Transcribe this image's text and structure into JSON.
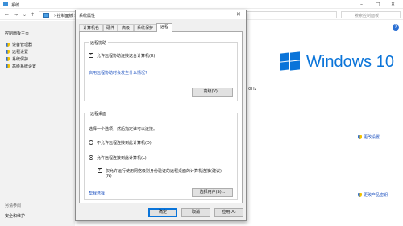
{
  "bg_window": {
    "title": "系统",
    "controls": [
      "–",
      "□",
      "✕"
    ],
    "breadcrumb": "› 控制面板 ›",
    "search_placeholder": "搜索控制面板",
    "left_pane": {
      "home": "控制面板主页",
      "items": [
        "设备管理器",
        "远程设置",
        "系统保护",
        "高级系统设置"
      ],
      "see_also": "另请参阅",
      "security": "安全和维护"
    },
    "logo_text": "Windows 10",
    "fragment_ghz": "GHz",
    "change_settings": "更改设置",
    "change_key": "更改产品密钥"
  },
  "dialog": {
    "title": "系统属性",
    "close": "✕",
    "tabs": [
      {
        "label": "计算机名"
      },
      {
        "label": "硬件"
      },
      {
        "label": "高级"
      },
      {
        "label": "系统保护"
      },
      {
        "label": "远程"
      }
    ],
    "active_tab": "远程",
    "remote_assistance": {
      "title": "远程协助",
      "allow_label": "允许远程协助连接这台计算机(R)",
      "allow_checked": true,
      "link": "启用远程协助时会发生什么情况?",
      "advanced_button": "高级(V)..."
    },
    "remote_desktop": {
      "title": "远程桌面",
      "instruction": "选择一个选项，然后指定谁可以连接。",
      "option_off": "不允许远程连接到此计算机(D)",
      "option_on": "允许远程连接到此计算机(L)",
      "selected": "on",
      "nla_label_line1": "仅允许运行使用网络级别身份验证的远程桌面的计算机连接(建议)",
      "nla_label_line2": "(N)",
      "nla_checked": true,
      "help_link": "帮我选择",
      "select_users_button": "选择用户(S)..."
    },
    "buttons": {
      "ok": "确定",
      "cancel": "取消",
      "apply": "应用(A)"
    }
  }
}
